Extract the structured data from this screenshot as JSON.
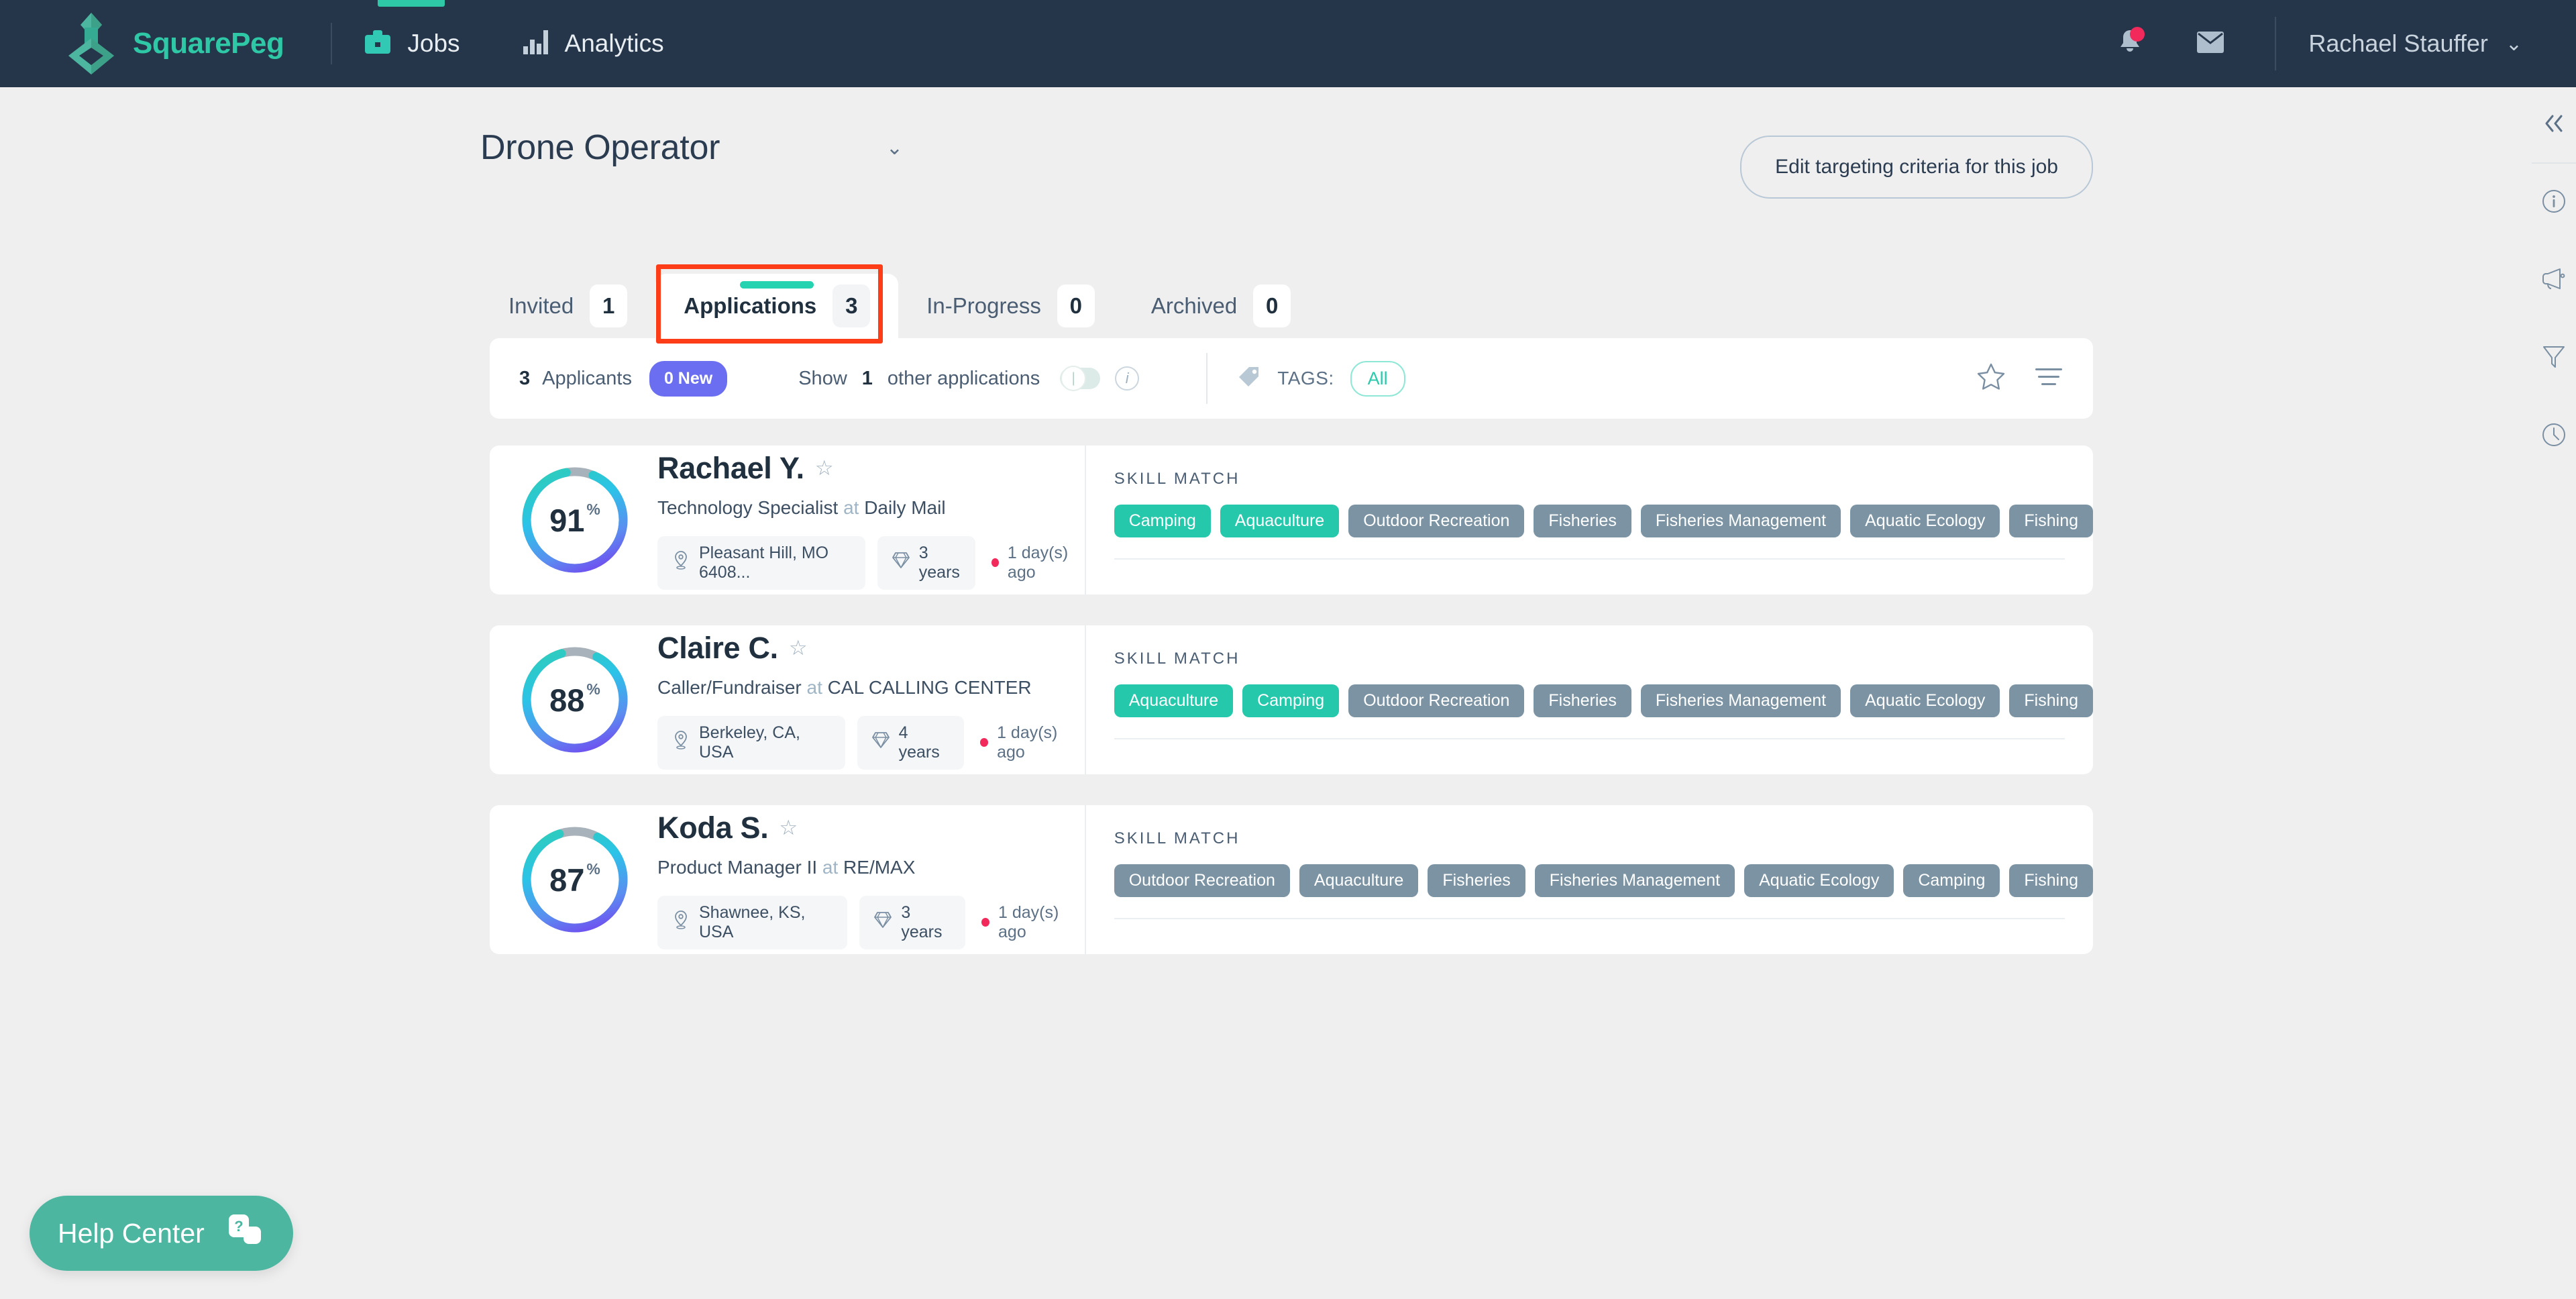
{
  "brand": {
    "name": "SquarePeg",
    "logo_icon": "squarepeg-logo"
  },
  "topnav": {
    "items": [
      {
        "label": "Jobs",
        "icon": "briefcase-icon",
        "active": true
      },
      {
        "label": "Analytics",
        "icon": "bar-chart-icon",
        "active": false
      }
    ],
    "notifications_icon": "bell-icon",
    "messages_icon": "envelope-icon",
    "user_name": "Rachael Stauffer",
    "user_caret": "⌄"
  },
  "job": {
    "title": "Drone Operator",
    "caret": "⌄",
    "edit_button": "Edit targeting criteria for this job"
  },
  "tabs": [
    {
      "label": "Invited",
      "count": "1",
      "active": false
    },
    {
      "label": "Applications",
      "count": "3",
      "active": true
    },
    {
      "label": "In-Progress",
      "count": "0",
      "active": false
    },
    {
      "label": "Archived",
      "count": "0",
      "active": false
    }
  ],
  "highlight_color": "#fc3d17",
  "toolbar": {
    "applicants_count": "3",
    "applicants_label": "Applicants",
    "new_badge": "0 New",
    "show_prefix": "Show",
    "show_count": "1",
    "show_suffix": "other applications",
    "toggle_on": false,
    "info_icon": "info-icon",
    "tag_icon": "tag-icon",
    "tags_label": "TAGS:",
    "tags_value": "All",
    "star_icon": "star-outline-icon",
    "sort_icon": "sort-lines-icon"
  },
  "candidates": [
    {
      "score": "91",
      "percent": "%",
      "name": "Rachael Y.",
      "star_icon": "star-outline-icon",
      "role": "Technology Specialist",
      "at": "at",
      "company": "Daily Mail",
      "location_icon": "location-pin-icon",
      "location": "Pleasant Hill, MO 6408...",
      "experience_icon": "diamond-icon",
      "experience": "3 years",
      "applied": "1 day(s) ago",
      "skill_label": "SKILL MATCH",
      "skills": [
        {
          "label": "Camping",
          "match": true
        },
        {
          "label": "Aquaculture",
          "match": true
        },
        {
          "label": "Outdoor Recreation",
          "match": false
        },
        {
          "label": "Fisheries",
          "match": false
        },
        {
          "label": "Fisheries Management",
          "match": false
        },
        {
          "label": "Aquatic Ecology",
          "match": false
        },
        {
          "label": "Fishing",
          "match": false
        }
      ]
    },
    {
      "score": "88",
      "percent": "%",
      "name": "Claire C.",
      "star_icon": "star-outline-icon",
      "role": "Caller/Fundraiser",
      "at": "at",
      "company": "CAL CALLING CENTER",
      "location_icon": "location-pin-icon",
      "location": "Berkeley, CA, USA",
      "experience_icon": "diamond-icon",
      "experience": "4 years",
      "applied": "1 day(s) ago",
      "skill_label": "SKILL MATCH",
      "skills": [
        {
          "label": "Aquaculture",
          "match": true
        },
        {
          "label": "Camping",
          "match": true
        },
        {
          "label": "Outdoor Recreation",
          "match": false
        },
        {
          "label": "Fisheries",
          "match": false
        },
        {
          "label": "Fisheries Management",
          "match": false
        },
        {
          "label": "Aquatic Ecology",
          "match": false
        },
        {
          "label": "Fishing",
          "match": false
        }
      ]
    },
    {
      "score": "87",
      "percent": "%",
      "name": "Koda S.",
      "star_icon": "star-outline-icon",
      "role": "Product Manager II",
      "at": "at",
      "company": "RE/MAX",
      "location_icon": "location-pin-icon",
      "location": "Shawnee, KS, USA",
      "experience_icon": "diamond-icon",
      "experience": "3 years",
      "applied": "1 day(s) ago",
      "skill_label": "SKILL MATCH",
      "skills": [
        {
          "label": "Outdoor Recreation",
          "match": false
        },
        {
          "label": "Aquaculture",
          "match": false
        },
        {
          "label": "Fisheries",
          "match": false
        },
        {
          "label": "Fisheries Management",
          "match": false
        },
        {
          "label": "Aquatic Ecology",
          "match": false
        },
        {
          "label": "Camping",
          "match": false
        },
        {
          "label": "Fishing",
          "match": false
        }
      ]
    }
  ],
  "rail": {
    "collapse_icon": "chevron-double-left-icon",
    "icons": [
      {
        "name": "info-circle-icon"
      },
      {
        "name": "megaphone-icon"
      },
      {
        "name": "funnel-filter-icon"
      },
      {
        "name": "clock-history-icon"
      }
    ]
  },
  "help": {
    "label": "Help Center",
    "icon": "help-cards-icon"
  },
  "colors": {
    "nav_bg": "#25364a",
    "accent_teal": "#2ec8a6",
    "page_bg": "#efefef",
    "badge_purple": "#6b6ef0",
    "red_dot": "#f2295b",
    "tag_match": "#25c8ab",
    "tag_nomatch": "#7b93a3",
    "highlight": "#fc3d17"
  }
}
